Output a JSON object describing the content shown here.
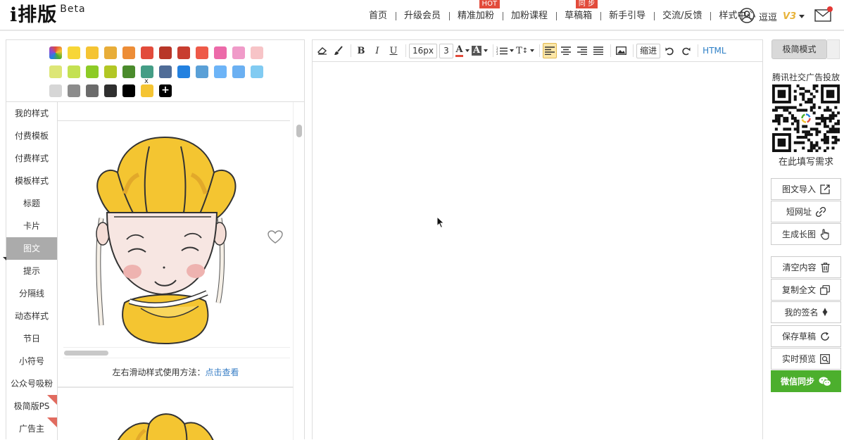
{
  "header": {
    "logo": "i排版",
    "beta": "Beta",
    "nav": [
      {
        "label": "首页",
        "badge": ""
      },
      {
        "label": "升级会员",
        "badge": ""
      },
      {
        "label": "精准加粉",
        "badge": "HOT"
      },
      {
        "label": "加粉课程",
        "badge": ""
      },
      {
        "label": "草稿箱",
        "badge": "同 步"
      },
      {
        "label": "新手引导",
        "badge": ""
      },
      {
        "label": "交流/反馈",
        "badge": ""
      },
      {
        "label": "样式中心",
        "badge": ""
      }
    ],
    "user_name": "逗逗",
    "vip_level": "V3"
  },
  "palette": {
    "rows": [
      [
        "multicolor",
        "#f7d637",
        "#f5c432",
        "#e8ad38",
        "#ed8d37",
        "#e24b3b",
        "#b83628",
        "#c83d30",
        "#ee5948",
        "#ec6aa9",
        "#f09bc9",
        "#f7c4c7"
      ],
      [
        "#dde676",
        "#c4e152",
        "#8dcb26",
        "#b2c725",
        "#4a8b2c",
        "#449d86",
        "#4f6c97",
        "#2381e0",
        "#5aa0d7",
        "#6db4f7",
        "#6bb0f2",
        "#81cbf2"
      ],
      [
        "#d6d6d6",
        "#8c8c8c",
        "#6b6b6b",
        "#2f2f2f",
        "#000000",
        "#f5c432",
        "add"
      ]
    ],
    "x_mark": "x",
    "add_label": "+"
  },
  "categories": [
    {
      "label": "我的样式",
      "active": false,
      "corner": false
    },
    {
      "label": "付费模板",
      "active": false,
      "corner": false
    },
    {
      "label": "付费样式",
      "active": false,
      "corner": false
    },
    {
      "label": "模板样式",
      "active": false,
      "corner": false
    },
    {
      "label": "标题",
      "active": false,
      "corner": false
    },
    {
      "label": "卡片",
      "active": false,
      "corner": false
    },
    {
      "label": "图文",
      "active": true,
      "corner": false
    },
    {
      "label": "提示",
      "active": false,
      "corner": false
    },
    {
      "label": "分隔线",
      "active": false,
      "corner": false
    },
    {
      "label": "动态样式",
      "active": false,
      "corner": false
    },
    {
      "label": "节日",
      "active": false,
      "corner": false
    },
    {
      "label": "小符号",
      "active": false,
      "corner": false
    },
    {
      "label": "公众号吸粉",
      "active": false,
      "corner": false
    },
    {
      "label": "极简版PS",
      "active": false,
      "corner": true
    },
    {
      "label": "广告主",
      "active": false,
      "corner": true
    }
  ],
  "style_item": {
    "tip_text": "左右滑动样式使用方法：",
    "tip_link": "点击查看"
  },
  "toolbar": {
    "font_size": "16px",
    "line_value": "3",
    "indent": "缩进",
    "html": "HTML"
  },
  "right": {
    "simple_mode": "极简模式",
    "ad_title": "腾讯社交广告投放",
    "ad_sub": "在此填写需求",
    "group1": [
      "图文导入",
      "短网址",
      "生成长图"
    ],
    "group2": [
      "清空内容",
      "复制全文",
      "我的签名"
    ],
    "group3": [
      "保存草稿",
      "实时预览",
      "微信同步"
    ]
  }
}
